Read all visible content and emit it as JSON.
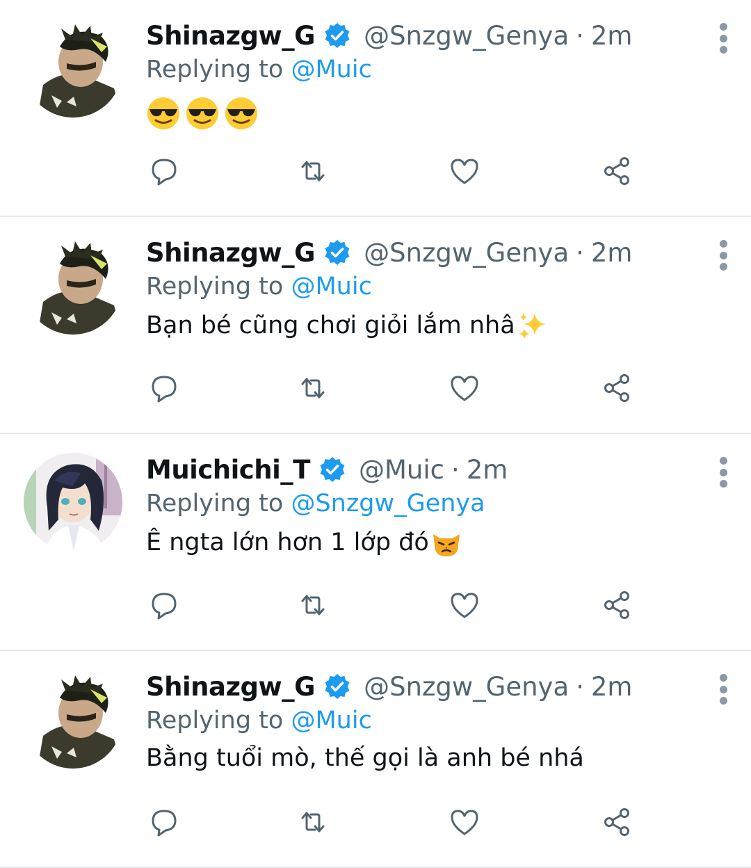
{
  "tweets": [
    {
      "avatar": "genya-avatar",
      "name": "Shinazgw_G",
      "handle": "@Snzgw_Genya",
      "separator": "·",
      "time": "2m",
      "replying_prefix": "Replying to",
      "replying_to": "@Muic",
      "text": "",
      "emojis": [
        "smiling-face-with-sunglasses",
        "smiling-face-with-sunglasses",
        "smiling-face-with-sunglasses"
      ]
    },
    {
      "avatar": "genya-avatar",
      "name": "Shinazgw_G",
      "handle": "@Snzgw_Genya",
      "separator": "·",
      "time": "2m",
      "replying_prefix": "Replying to",
      "replying_to": "@Muic",
      "text": "Bạn bé cũng chơi giỏi lắm nhâ",
      "emojis": [
        "sparkles"
      ]
    },
    {
      "avatar": "muichiro-avatar",
      "name": "Muichichi_T",
      "handle": "@Muic",
      "separator": "·",
      "time": "2m",
      "replying_prefix": "Replying to",
      "replying_to": "@Snzgw_Genya",
      "text": "Ê ngta lớn hơn 1 lớp đó",
      "emojis": [
        "pouting-cat"
      ]
    },
    {
      "avatar": "genya-avatar",
      "name": "Shinazgw_G",
      "handle": "@Snzgw_Genya",
      "separator": "·",
      "time": "2m",
      "replying_prefix": "Replying to",
      "replying_to": "@Muic",
      "text": "Bằng tuổi mò, thế gọi là anh bé nhá",
      "emojis": []
    }
  ],
  "icons": {
    "verified": "verified-badge-icon",
    "reply": "reply-icon",
    "retweet": "retweet-icon",
    "like": "heart-icon",
    "share": "share-icon",
    "more": "more-vertical-icon"
  },
  "colors": {
    "text": "#0f1419",
    "secondary": "#536471",
    "accent": "#1d9bf0",
    "divider": "#e6ecf0"
  }
}
